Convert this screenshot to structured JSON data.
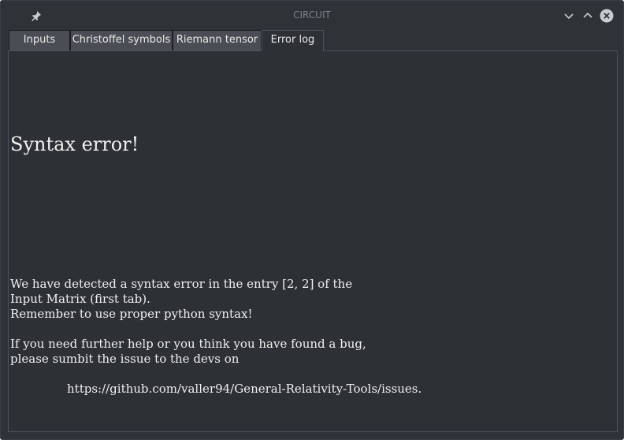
{
  "window": {
    "title": "CIRCUIT"
  },
  "tabs": [
    {
      "label": "Inputs",
      "active": false
    },
    {
      "label": "Christoffel symbols",
      "active": false
    },
    {
      "label": "Riemann tensor",
      "active": false
    },
    {
      "label": "Error log",
      "active": true
    }
  ],
  "error": {
    "title": "Syntax error!",
    "lines": [
      "We have detected a syntax error in the entry [2, 2] of the",
      "Input Matrix (first tab).",
      "Remember to use proper python syntax!",
      "If you need further help or you think you have found a bug,",
      "please sumbit the issue to the devs on"
    ],
    "link": "https://github.com/valler94/General-Relativity-Tools/issues."
  },
  "colors": {
    "background": "#2f3237",
    "panel": "#2d3035",
    "tab_inactive": "#4a4e54",
    "text": "#f0f0f0",
    "close_button": "#c8ccd0"
  },
  "icons": {
    "pin": "pin-icon",
    "minimize": "chevron-down-icon",
    "maximize": "chevron-up-icon",
    "close": "close-icon"
  }
}
